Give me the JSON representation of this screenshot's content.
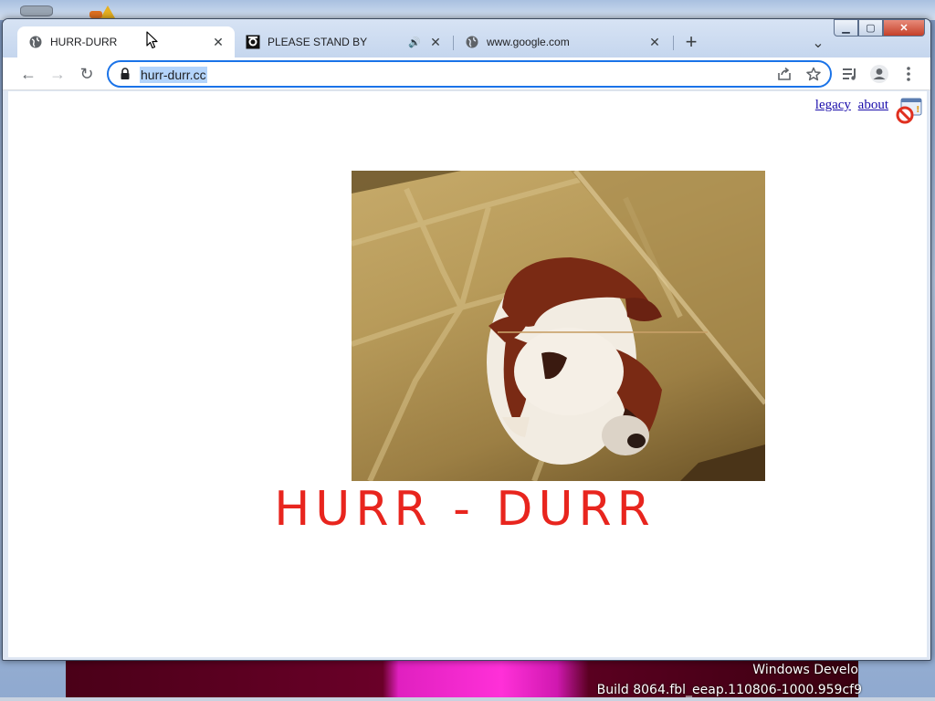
{
  "watermark": {
    "line1": "Windows Develo",
    "line2": "Build 8064.fbl_eeap.110806-1000.959cf9"
  },
  "tabs": [
    {
      "title": "HURR-DURR",
      "close": "✕",
      "active": true
    },
    {
      "title": "PLEASE STAND BY",
      "close": "✕",
      "audio": "🔊"
    },
    {
      "title": "www.google.com",
      "close": "✕"
    }
  ],
  "newtab_label": "+",
  "tabsearch_label": "⌄",
  "caption": {
    "minimize": "▁",
    "maximize": "▢",
    "close": "✕"
  },
  "toolbar": {
    "back": "←",
    "forward": "→",
    "reload": "↻",
    "url": "hurr-durr.cc"
  },
  "page": {
    "links": {
      "legacy": "legacy",
      "about": "about"
    },
    "heading": "HURR - DURR"
  },
  "colors": {
    "heading": "#e8251e",
    "omnibox_border": "#1a73e8",
    "link": "#1a0dab"
  }
}
